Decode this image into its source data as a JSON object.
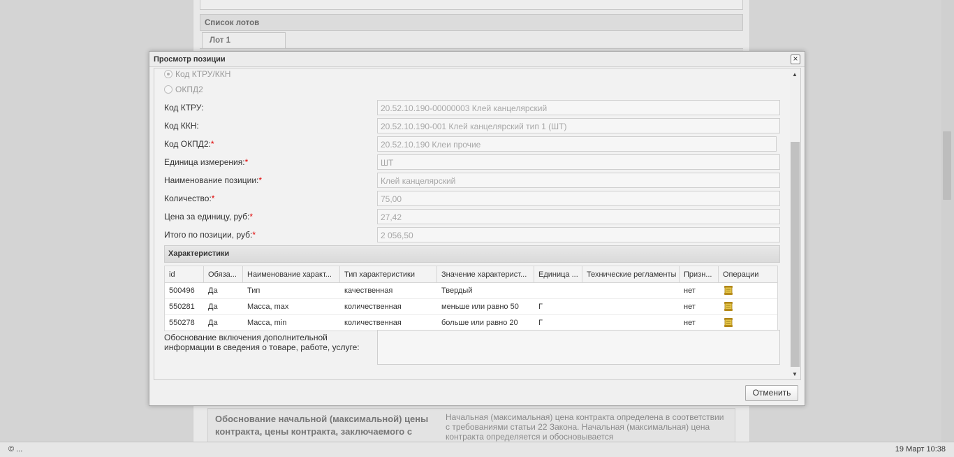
{
  "background": {
    "lots_header": "Список лотов",
    "lot_tab": "Лот 1",
    "bottom_label": "Обоснование начальной (максимальной) цены контракта, цены контракта, заключаемого с",
    "bottom_text": "Начальная (максимальная) цена контракта определена в соответствии с требованиями статьи 22 Закона. Начальная (максимальная) цена контракта определяется и обосновывается"
  },
  "statusbar": {
    "left": "© ...",
    "right": "19 Март 10:38"
  },
  "dialog": {
    "title": "Просмотр позиции",
    "close": "×",
    "radios": [
      {
        "label": "Код КТРУ/ККН",
        "selected": true
      },
      {
        "label": "ОКПД2",
        "selected": false
      }
    ],
    "fields": [
      {
        "label": "Код КТРУ:",
        "required": false,
        "value": "20.52.10.190-00000003 Клей канцелярский"
      },
      {
        "label": "Код ККН:",
        "required": false,
        "value": "20.52.10.190-001 Клей канцелярский тип 1 (ШТ)"
      },
      {
        "label": "Код ОКПД2:",
        "required": true,
        "value": "20.52.10.190 Клеи прочие"
      },
      {
        "label": "Единица измерения:",
        "required": true,
        "value": "ШТ"
      },
      {
        "label": "Наименование позиции:",
        "required": true,
        "value": "Клей канцелярский"
      },
      {
        "label": "Количество:",
        "required": true,
        "value": "75,00"
      },
      {
        "label": "Цена за единицу, руб:",
        "required": true,
        "value": "27,42"
      },
      {
        "label": "Итого по позиции, руб:",
        "required": true,
        "value": "2 056,50"
      }
    ],
    "required_mark": "*",
    "characteristics": {
      "title": "Характеристики",
      "columns": [
        "id",
        "Обяза...",
        "Наименование характ...",
        "Тип характеристики",
        "Значение характерист...",
        "Единица ...",
        "Технические регламенты",
        "Призн...",
        "Операции"
      ],
      "rows": [
        [
          "500496",
          "Да",
          "Тип",
          "качественная",
          "Твердый",
          "",
          "",
          "нет"
        ],
        [
          "550281",
          "Да",
          "Масса, max",
          "количественная",
          "меньше или равно 50",
          "Г",
          "",
          "нет"
        ],
        [
          "550278",
          "Да",
          "Масса, min",
          "количественная",
          "больше или равно 20",
          "Г",
          "",
          "нет"
        ]
      ],
      "operation_icon": "scroll-icon"
    },
    "justification_label": "Обоснование включения дополнительной информации в сведения о товаре, работе, услуге:",
    "justification_value": "",
    "cancel_label": "Отменить"
  }
}
